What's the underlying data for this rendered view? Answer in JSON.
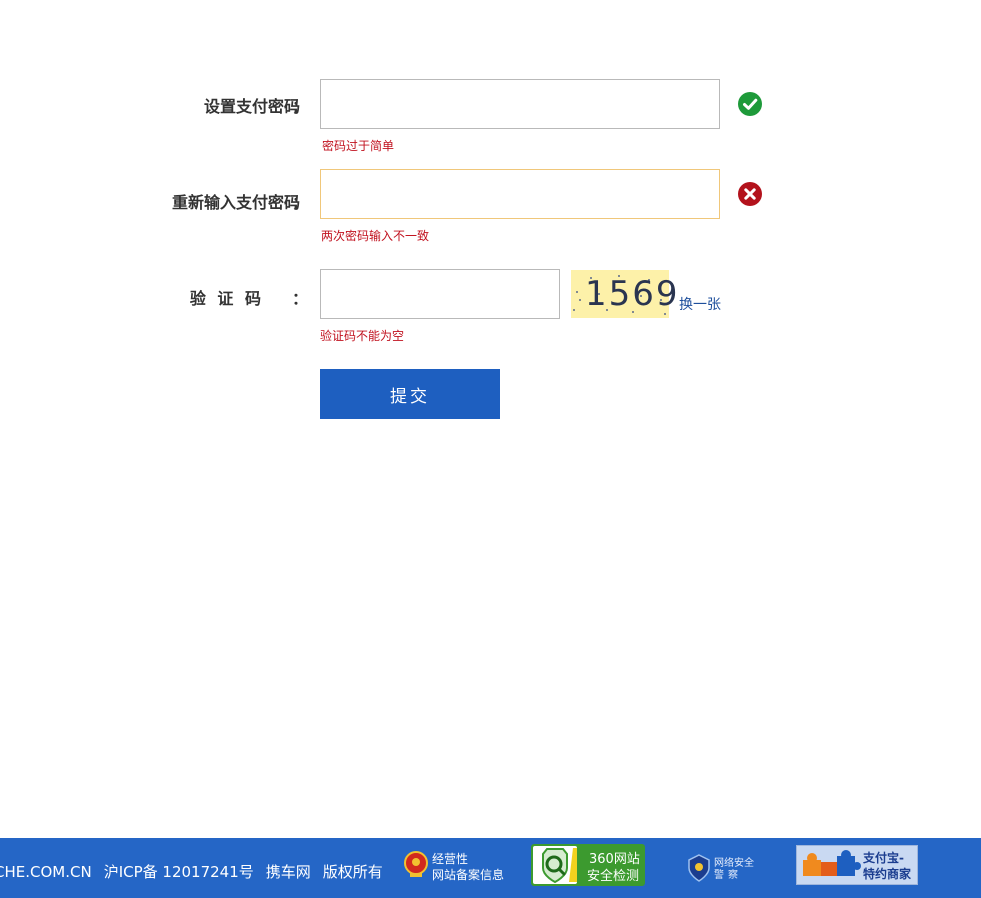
{
  "form": {
    "pay_password": {
      "label": "设置支付密码",
      "colon": "：",
      "value": "",
      "status": "valid",
      "message": "密码过于简单"
    },
    "confirm_password": {
      "label": "重新输入支付密码",
      "colon": "：",
      "value": "",
      "status": "invalid",
      "message": "两次密码输入不一致"
    },
    "captcha": {
      "label": "验 证 码",
      "colon": "：",
      "value": "",
      "image_text": "1569",
      "refresh_label": "换一张",
      "message": "验证码不能为空"
    },
    "submit_label": "提交"
  },
  "footer": {
    "domain": "CHE.COM.CN",
    "icp": "沪ICP备 12017241号",
    "site": "携车网",
    "copyright": "版权所有",
    "badges": {
      "beian_line1": "经营性",
      "beian_line2": "网站备案信息",
      "security360_line1": "360网站",
      "security360_line2": "安全检测",
      "police_line1": "网络安全",
      "police_line2": "警察",
      "alipay_line1": "支付宝-",
      "alipay_line2": "特约商家"
    }
  },
  "colors": {
    "success": "#1e9a3a",
    "error": "#b3121c",
    "error_text": "#c1121f",
    "accent": "#1e5fc0",
    "footer": "#2566c6",
    "link": "#1e4f9c"
  },
  "icons": {
    "valid": "check-circle-icon",
    "invalid": "x-circle-icon"
  }
}
